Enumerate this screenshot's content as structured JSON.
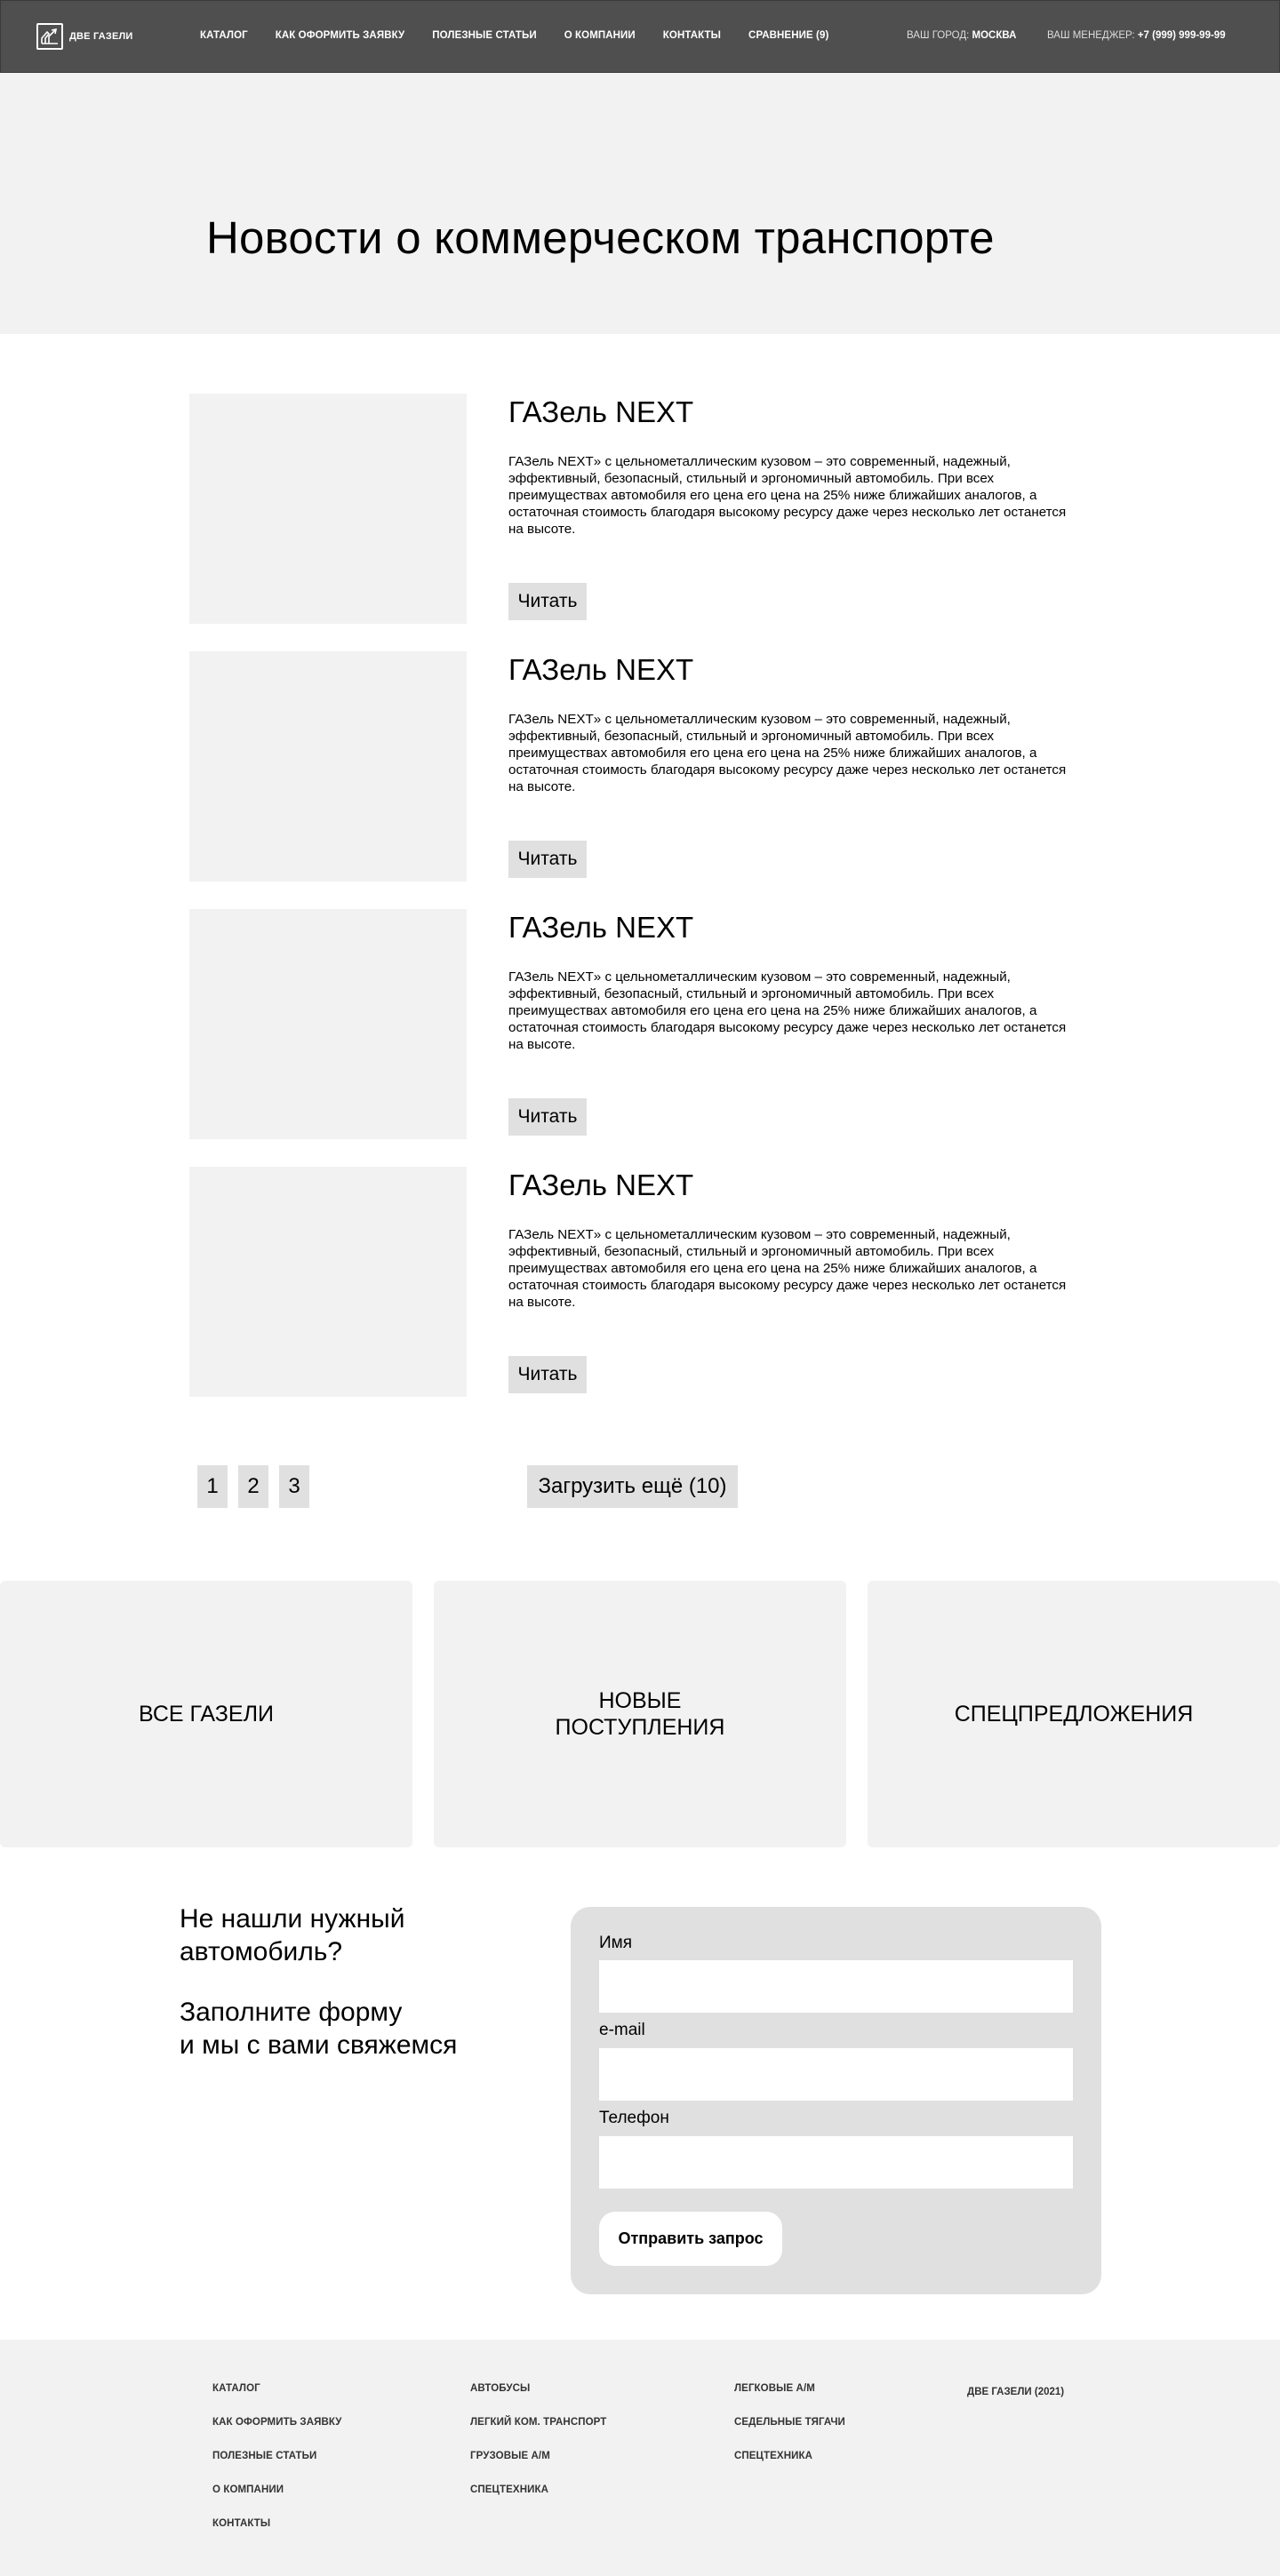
{
  "header": {
    "logo_text": "ДВЕ ГАЗЕЛИ",
    "nav": [
      "КАТАЛОГ",
      "КАК  ОФОРМИТЬ ЗАЯВКУ",
      "ПОЛЕЗНЫЕ СТАТЬИ",
      "О КОМПАНИИ",
      "КОНТАКТЫ",
      "СРАВНЕНИЕ (9)"
    ],
    "city_label": "ВАШ ГОРОД: ",
    "city_value": "МОСКВА",
    "manager_label": "ВАШ МЕНЕДЖЕР: ",
    "manager_phone": "+7 (999) 999-99-99"
  },
  "hero": {
    "title": "Новости о коммерческом транспорте"
  },
  "articles": [
    {
      "title": "ГАЗель NEXT",
      "text": "ГАЗель NEXT» с цельнометаллическим кузовом – это современный, надежный, эффективный, безопасный, стильный и эргономичный автомобиль. При всех преимуществах автомобиля его цена его цена на 25% ниже ближайших аналогов, а остаточная стоимость благодаря высокому ресурсу даже через несколько лет останется на высоте.",
      "button": "Читать"
    },
    {
      "title": "ГАЗель NEXT",
      "text": "ГАЗель NEXT» с цельнометаллическим кузовом – это современный, надежный, эффективный, безопасный, стильный и эргономичный автомобиль. При всех преимуществах автомобиля его цена его цена на 25% ниже ближайших аналогов, а остаточная стоимость благодаря высокому ресурсу даже через несколько лет останется на высоте.",
      "button": "Читать"
    },
    {
      "title": "ГАЗель NEXT",
      "text": "ГАЗель NEXT» с цельнометаллическим кузовом – это современный, надежный, эффективный, безопасный, стильный и эргономичный автомобиль. При всех преимуществах автомобиля его цена его цена на 25% ниже ближайших аналогов, а остаточная стоимость благодаря высокому ресурсу даже через несколько лет останется на высоте.",
      "button": "Читать"
    },
    {
      "title": "ГАЗель NEXT",
      "text": "ГАЗель NEXT» с цельнометаллическим кузовом – это современный, надежный, эффективный, безопасный, стильный и эргономичный автомобиль. При всех преимуществах автомобиля его цена его цена на 25% ниже ближайших аналогов, а остаточная стоимость благодаря высокому ресурсу даже через несколько лет останется на высоте.",
      "button": "Читать"
    }
  ],
  "pagination": {
    "pages": [
      "1",
      "2",
      "3"
    ],
    "load_more": "Загрузить ещё (10)"
  },
  "categories": [
    "ВСЕ ГАЗЕЛИ",
    "НОВЫЕ\nПОСТУПЛЕНИЯ",
    "СПЕЦПРЕДЛОЖЕНИЯ"
  ],
  "contact": {
    "heading": "Не нашли нужный\nавтомобиль?",
    "subheading": "Заполните форму\nи мы с вами свяжемся",
    "name_label": "Имя",
    "email_label": "e-mail",
    "phone_label": "Телефон",
    "submit": "Отправить запрос"
  },
  "footer": {
    "col1": [
      "КАТАЛОГ",
      "КАК  ОФОРМИТЬ ЗАЯВКУ",
      "ПОЛЕЗНЫЕ СТАТЬИ",
      "О КОМПАНИИ",
      "КОНТАКТЫ"
    ],
    "col2": [
      "АВТОБУСЫ",
      "ЛЕГКИЙ КОМ. ТРАНСПОРТ",
      "ГРУЗОВЫЕ А/М",
      "СПЕЦТЕХНИКА"
    ],
    "col3": [
      "ЛЕГКОВЫЕ А/М",
      "СЕДЕЛЬНЫЕ ТЯГАЧИ",
      "СПЕЦТЕХНИКА"
    ],
    "copyright": "ДВЕ ГАЗЕЛИ (2021)"
  },
  "colors": {
    "header_bg": "#4f4f4f",
    "section_bg": "#f2f2f2",
    "button_bg": "#e0e0e0"
  },
  "icons": {
    "logo": "truck-logo-icon"
  }
}
